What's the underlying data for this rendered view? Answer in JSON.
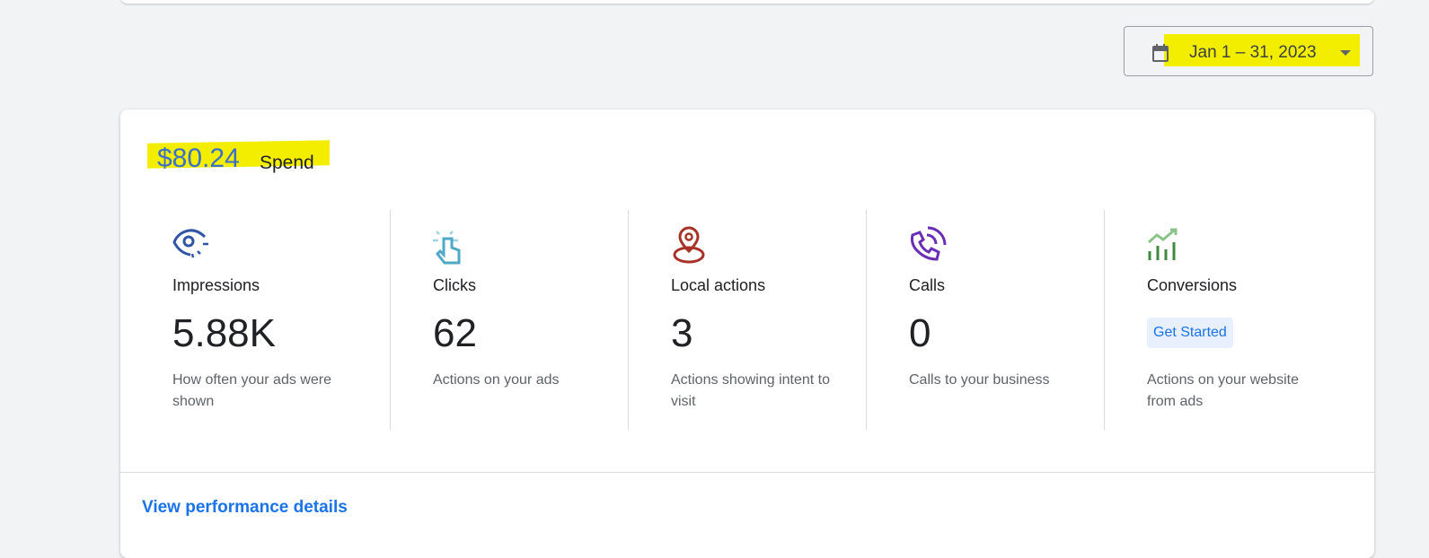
{
  "date_range": {
    "label": "Jan 1 – 31, 2023",
    "icon": "calendar-icon"
  },
  "spend": {
    "amount": "$80.24",
    "label": "Spend"
  },
  "metrics": [
    {
      "label": "Impressions",
      "value": "5.88K",
      "description": "How often your ads were shown",
      "icon": "eye-icon",
      "color": "#2f55a4"
    },
    {
      "label": "Clicks",
      "value": "62",
      "description": "Actions on your ads",
      "icon": "tap-icon",
      "color": "#4fa8c5"
    },
    {
      "label": "Local actions",
      "value": "3",
      "description": "Actions showing intent to visit",
      "icon": "location-pin-icon",
      "color": "#a93226"
    },
    {
      "label": "Calls",
      "value": "0",
      "description": "Calls to your business",
      "icon": "phone-icon",
      "color": "#6a2db5"
    },
    {
      "label": "Conversions",
      "button": "Get Started",
      "description": "Actions on your website from ads",
      "icon": "trend-chart-icon",
      "color": "#3e8a3e"
    }
  ],
  "footer": {
    "link": "View performance details"
  }
}
